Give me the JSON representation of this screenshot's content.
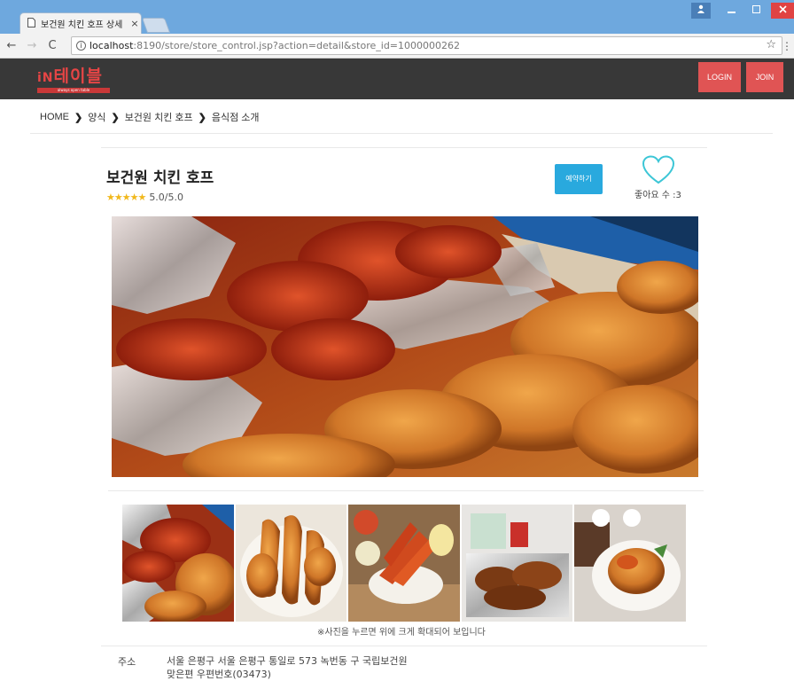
{
  "browser": {
    "tab_title": "보건원 치킨 호프 상세",
    "tab_close": "×",
    "url_host": "localhost",
    "url_path": ":8190/store/store_control.jsp?action=detail&store_id=1000000262",
    "nav_back": "←",
    "nav_forward": "→",
    "nav_reload": "C"
  },
  "header": {
    "logo_prefix": "iN",
    "logo_main": "테이블",
    "logo_sub": "always open table",
    "login_label": "LOGIN",
    "join_label": "JOIN"
  },
  "breadcrumb": {
    "items": [
      "HOME",
      "양식",
      "보건원 치킨 호프",
      "음식점 소개"
    ],
    "separator": "❯"
  },
  "store": {
    "name": "보건원 치킨 호프",
    "stars": "★★★★★",
    "rating_text": "5.0/5.0",
    "reserve_label": "예약하기",
    "like_label": "좋아요 수 :3",
    "photo_hint": "※사진을 누르면 위에 크게 확대되어 보입니다",
    "address_label": "주소",
    "address_line1": "서울 은평구 서울 은평구 통일로 573 녹번동 구 국립보건원",
    "address_line2": "맞은편 우편번호(03473)"
  },
  "colors": {
    "header_bg": "#383838",
    "accent_red": "#e05454",
    "reserve_blue": "#29a9de",
    "heart_cyan": "#3cc6d6",
    "star_gold": "#f1b81c"
  },
  "icons": [
    "page-icon",
    "back-arrow-icon",
    "forward-arrow-icon",
    "reload-icon",
    "info-icon",
    "star-bookmark-icon",
    "heart-icon",
    "chevron-right-icon"
  ]
}
